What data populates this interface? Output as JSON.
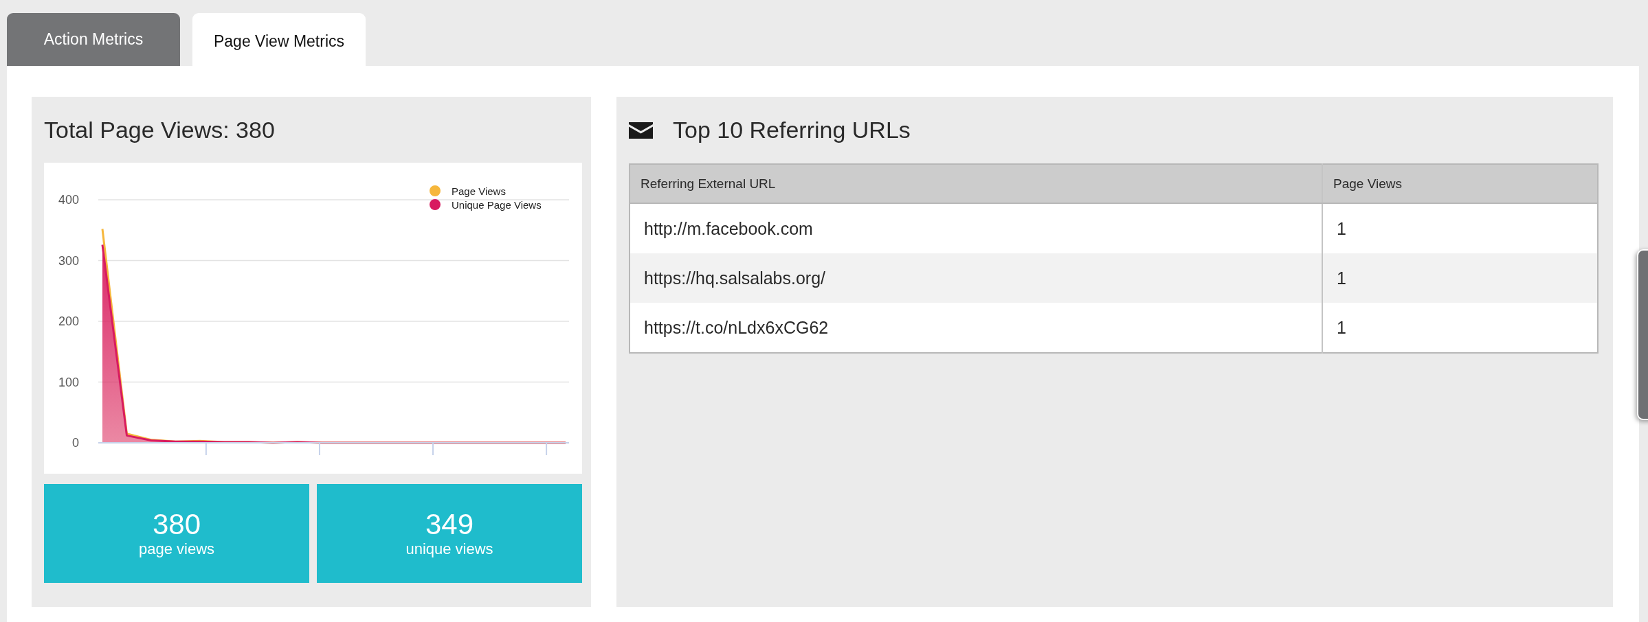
{
  "tabs": [
    {
      "label": "Action Metrics",
      "selected": false
    },
    {
      "label": "Page View Metrics",
      "selected": true
    }
  ],
  "page_views_card": {
    "title": "Total Page Views: 380",
    "chart_data": {
      "type": "area",
      "series": [
        {
          "name": "Page Views",
          "color": "#f6b73c",
          "values": [
            352,
            15,
            5,
            2,
            3,
            1,
            1,
            0,
            1,
            0,
            0,
            0,
            0,
            0,
            0,
            0,
            0,
            0,
            0,
            0
          ]
        },
        {
          "name": "Unique Page Views",
          "color": "#d81b60",
          "values": [
            326,
            12,
            4,
            2,
            2,
            1,
            1,
            0,
            1,
            0,
            0,
            0,
            0,
            0,
            0,
            0,
            0,
            0,
            0,
            0
          ]
        }
      ],
      "ylim": [
        0,
        400
      ],
      "yticks": [
        0,
        100,
        200,
        300,
        400
      ],
      "grid": true,
      "legend": true
    },
    "stats": [
      {
        "value": "380",
        "label": "page views"
      },
      {
        "value": "349",
        "label": "unique views"
      }
    ]
  },
  "referrers_card": {
    "title": "Top 10 Referring URLs",
    "table": {
      "columns": [
        "Referring External URL",
        "Page Views"
      ],
      "rows": [
        [
          "http://m.facebook.com",
          "1"
        ],
        [
          "https://hq.salsalabs.org/",
          "1"
        ],
        [
          "https://t.co/nLdx6xCG62",
          "1"
        ]
      ]
    }
  }
}
